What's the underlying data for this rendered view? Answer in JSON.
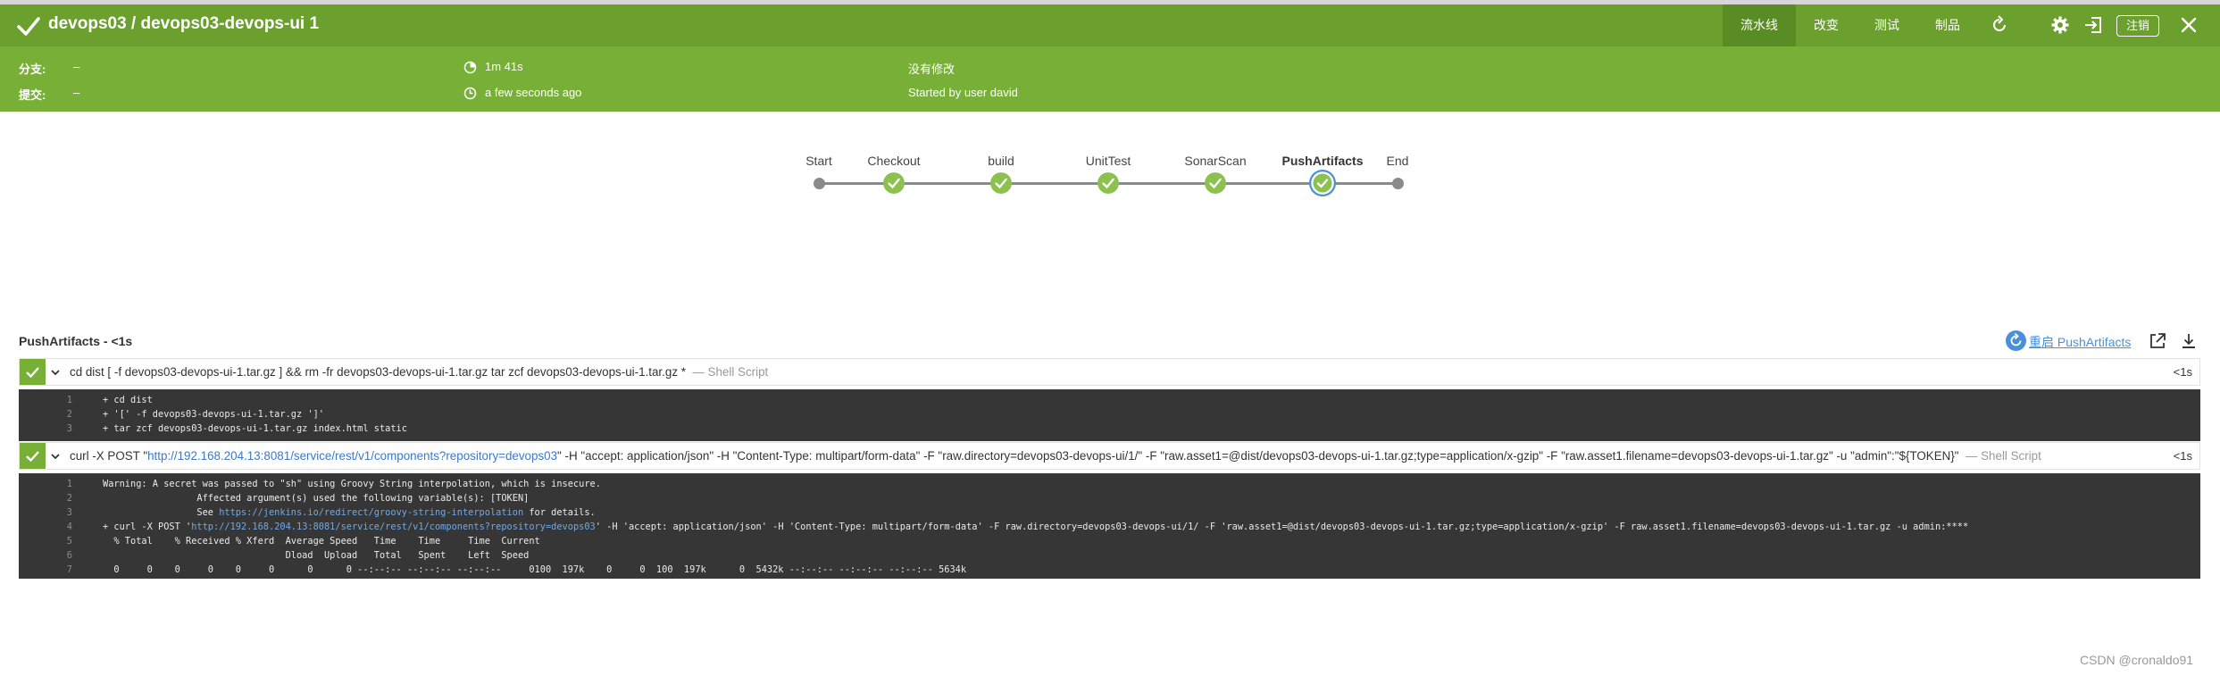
{
  "header": {
    "title": "devops03 / devops03-devops-ui  1",
    "tabs": [
      "流水线",
      "改变",
      "测试",
      "制品"
    ],
    "logout_label": "注销",
    "branch_label": "分支:",
    "branch_value": "–",
    "commit_label": "提交:",
    "commit_value": "–",
    "duration": "1m 41s",
    "time_ago": "a few seconds ago",
    "changes": "没有修改",
    "started_by": "Started by user david"
  },
  "pipeline": {
    "stages": [
      "Start",
      "Checkout",
      "build",
      "UnitTest",
      "SonarScan",
      "PushArtifacts",
      "End"
    ],
    "current_stage": "PushArtifacts"
  },
  "detail": {
    "title": "PushArtifacts - <1s",
    "restart_label": "重启 PushArtifacts",
    "steps": [
      {
        "command": "cd dist [ -f devops03-devops-ui-1.tar.gz ] && rm -fr devops03-devops-ui-1.tar.gz tar zcf devops03-devops-ui-1.tar.gz *",
        "type": "— Shell Script",
        "duration": "<1s",
        "log": [
          {
            "num": "1",
            "text": "+ cd dist"
          },
          {
            "num": "2",
            "text": "+ '[' -f devops03-devops-ui-1.tar.gz ']'"
          },
          {
            "num": "3",
            "text": "+ tar zcf devops03-devops-ui-1.tar.gz index.html static"
          }
        ]
      },
      {
        "command_pre": "curl -X POST \"",
        "command_url": "http://192.168.204.13:8081/service/rest/v1/components?repository=devops03",
        "command_post": "\" -H \"accept: application/json\" -H \"Content-Type: multipart/form-data\" -F \"raw.directory=devops03-devops-ui/1/\" -F \"raw.asset1=@dist/devops03-devops-ui-1.tar.gz;type=application/x-gzip\" -F \"raw.asset1.filename=devops03-devops-ui-1.tar.gz\" -u \"admin\":\"${TOKEN}\"",
        "type": "— Shell Script",
        "duration": "<1s",
        "log": [
          {
            "num": "1",
            "text": "Warning: A secret was passed to \"sh\" using Groovy String interpolation, which is insecure."
          },
          {
            "num": "2",
            "text": "                 Affected argument(s) used the following variable(s): [TOKEN]"
          },
          {
            "num": "3",
            "pre": "                 See ",
            "url": "https://jenkins.io/redirect/groovy-string-interpolation",
            "post": " for details."
          },
          {
            "num": "4",
            "pre": "+ curl -X POST '",
            "url": "http://192.168.204.13:8081/service/rest/v1/components?repository=devops03",
            "post": "' -H 'accept: application/json' -H 'Content-Type: multipart/form-data' -F raw.directory=devops03-devops-ui/1/ -F 'raw.asset1=@dist/devops03-devops-ui-1.tar.gz;type=application/x-gzip' -F raw.asset1.filename=devops03-devops-ui-1.tar.gz -u admin:****"
          },
          {
            "num": "5",
            "text": "  % Total    % Received % Xferd  Average Speed   Time    Time     Time  Current"
          },
          {
            "num": "6",
            "text": "                                 Dload  Upload   Total   Spent    Left  Speed"
          },
          {
            "num": "7",
            "text": "  0     0    0     0    0     0      0      0 --:--:-- --:--:-- --:--:--     0100  197k    0     0  100  197k      0  5432k --:--:-- --:--:-- --:--:-- 5634k"
          }
        ]
      }
    ]
  },
  "watermark": "CSDN @cronaldo91",
  "colors": {
    "header_green": "#78b037",
    "header_dark": "#6ba02f",
    "active_tab": "#5a8c25",
    "success_green": "#8cc04f",
    "current_ring": "#4a90d9",
    "log_bg": "#363636"
  }
}
